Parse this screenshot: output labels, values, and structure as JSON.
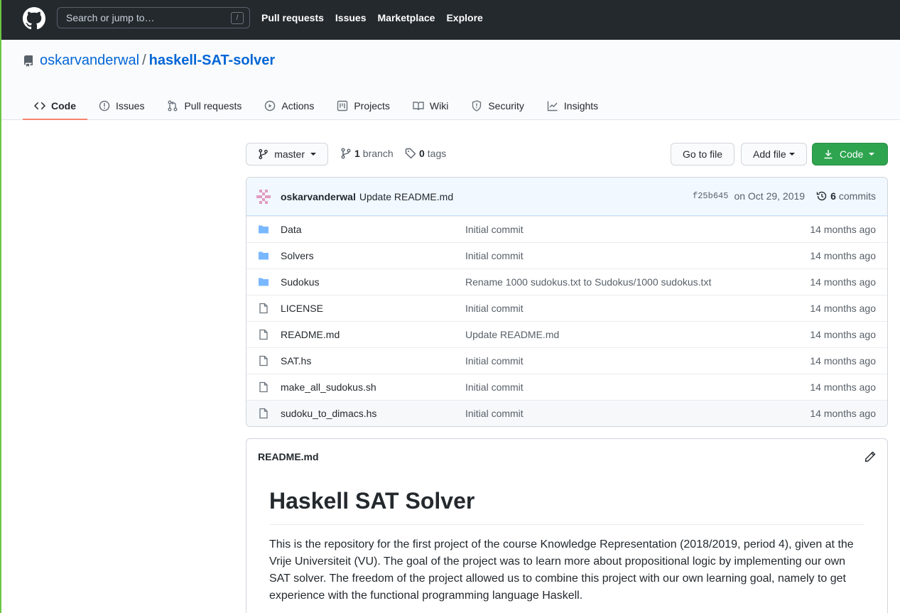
{
  "header": {
    "search_placeholder": "Search or jump to…",
    "search_key": "/",
    "nav": [
      "Pull requests",
      "Issues",
      "Marketplace",
      "Explore"
    ]
  },
  "repo": {
    "owner": "oskarvanderwal",
    "separator": "/",
    "name": "haskell-SAT-solver"
  },
  "tabs": [
    {
      "label": "Code",
      "icon": "code-icon"
    },
    {
      "label": "Issues",
      "icon": "issue-icon"
    },
    {
      "label": "Pull requests",
      "icon": "pull-request-icon"
    },
    {
      "label": "Actions",
      "icon": "play-icon"
    },
    {
      "label": "Projects",
      "icon": "project-icon"
    },
    {
      "label": "Wiki",
      "icon": "book-icon"
    },
    {
      "label": "Security",
      "icon": "shield-icon"
    },
    {
      "label": "Insights",
      "icon": "graph-icon"
    }
  ],
  "file_nav": {
    "branch": "master",
    "branch_count": "1",
    "branch_label": "branch",
    "tag_count": "0",
    "tag_label": "tags",
    "go_to_file": "Go to file",
    "add_file": "Add file",
    "code": "Code"
  },
  "commit": {
    "author": "oskarvanderwal",
    "message": "Update README.md",
    "sha": "f25b645",
    "date": "on Oct 29, 2019",
    "commit_count": "6",
    "commit_label": "commits"
  },
  "files": [
    {
      "type": "dir",
      "name": "Data",
      "commit": "Initial commit",
      "age": "14 months ago"
    },
    {
      "type": "dir",
      "name": "Solvers",
      "commit": "Initial commit",
      "age": "14 months ago"
    },
    {
      "type": "dir",
      "name": "Sudokus",
      "commit": "Rename 1000 sudokus.txt to Sudokus/1000 sudokus.txt",
      "age": "14 months ago"
    },
    {
      "type": "file",
      "name": "LICENSE",
      "commit": "Initial commit",
      "age": "14 months ago"
    },
    {
      "type": "file",
      "name": "README.md",
      "commit": "Update README.md",
      "age": "14 months ago"
    },
    {
      "type": "file",
      "name": "SAT.hs",
      "commit": "Initial commit",
      "age": "14 months ago"
    },
    {
      "type": "file",
      "name": "make_all_sudokus.sh",
      "commit": "Initial commit",
      "age": "14 months ago"
    },
    {
      "type": "file",
      "name": "sudoku_to_dimacs.hs",
      "commit": "Initial commit",
      "age": "14 months ago"
    }
  ],
  "readme": {
    "filename": "README.md",
    "title": "Haskell SAT Solver",
    "paragraph": "This is the repository for the first project of the course Knowledge Representation (2018/2019, period 4), given at the Vrije Universiteit (VU). The goal of the project was to learn more about propositional logic by implementing our own SAT solver. The freedom of the project allowed us to combine this project with our own learning goal, namely to get experience with the functional programming language Haskell."
  },
  "colors": {
    "header_bg": "#24292e",
    "link": "#0366d6",
    "primary_button": "#2ea44f",
    "active_tab_underline": "#f9826c",
    "folder_icon": "#79b8ff"
  }
}
